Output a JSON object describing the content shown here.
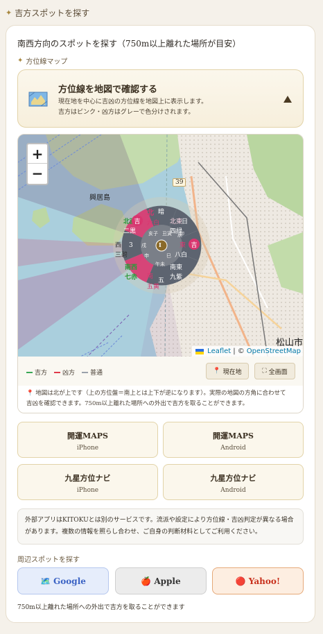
{
  "header": {
    "title": "吉方スポットを探す"
  },
  "card": {
    "title": "南西方向のスポットを探す（750m以上離れた場所が目安）",
    "map_section_title": "方位線マップ"
  },
  "toggle": {
    "title": "方位線を地図で確認する",
    "desc_line1": "現在地を中心に吉凶の方位線を地図上に表示します。",
    "desc_line2": "吉方はピンク・凶方はグレーで色分けされます。"
  },
  "map": {
    "zoom_in": "+",
    "zoom_out": "−",
    "road_number": "39",
    "place_okinoshima": "興居島",
    "place_matsuyama": "松山市",
    "attribution_leaflet": "Leaflet",
    "attribution_sep": "| ©",
    "attribution_osm": "OpenStreetMap",
    "compass": {
      "n": "北",
      "n_star": "暗",
      "n_sub": "六白",
      "ne": "北東",
      "ne_sub": "四緑",
      "ne_day": "日",
      "e": "東",
      "e_mark": "吉",
      "e_sub": "八白",
      "e_kan": "卯",
      "se": "南東",
      "se_sub": "九紫",
      "s": "南",
      "s_sub": "五黄",
      "s_kan": "五",
      "sw": "南西",
      "sw_sub": "七赤",
      "w": "西",
      "w_sub": "三碧",
      "w_num": "3",
      "nw": "北西",
      "nw_sub": "二黒",
      "nw_mark": "吉",
      "center": "I",
      "inner_tl": "亥子",
      "inner_tr": "丑寅",
      "inner_l": "戌",
      "inner_r": "辰",
      "inner_bl": "申",
      "inner_br": "巳",
      "inner_b": "午未"
    },
    "colors": {
      "lucky": "#d9366f",
      "unlucky": "#5d6470",
      "normal": "#c7b9a0",
      "lucky_green": "#2a9a3a"
    }
  },
  "legend": {
    "lucky": "吉方",
    "unlucky": "凶方",
    "normal": "普通",
    "lucky_color": "#3aa856",
    "unlucky_color": "#e03a4a",
    "normal_color": "#9aa0aa"
  },
  "map_buttons": {
    "current": "現在地",
    "current_icon": "📍",
    "fullscreen": "全画面",
    "fullscreen_icon": "⛶"
  },
  "map_note": {
    "icon": "📍",
    "line1": "地図は北が上です（上の方位盤＝南上とは上下が逆になります）。実際の地図の方角に合わせて",
    "line2": "吉凶を確認できます。750m以上離れた場所への外出で吉方を取ることができます。"
  },
  "apps": [
    {
      "name": "開運MAPS",
      "os": "iPhone"
    },
    {
      "name": "開運MAPS",
      "os": "Android"
    },
    {
      "name": "九星方位ナビ",
      "os": "iPhone"
    },
    {
      "name": "九星方位ナビ",
      "os": "Android"
    }
  ],
  "disclaimer": {
    "line1": "外部アプリはKITOKUとは別のサービスです。流派や設定により方位線・吉凶判定が異なる場合",
    "line2": "があります。複数の情報を照らし合わせ、ご自身の判断材料としてご利用ください。"
  },
  "nearby": {
    "title": "周辺スポットを探す",
    "google": "Google",
    "google_icon": "🗺️",
    "apple": "Apple",
    "apple_icon": "🍎",
    "yahoo": "Yahoo!",
    "yahoo_icon": "🔴"
  },
  "footer_note": "750m以上離れた場所への外出で吉方を取ることができます"
}
